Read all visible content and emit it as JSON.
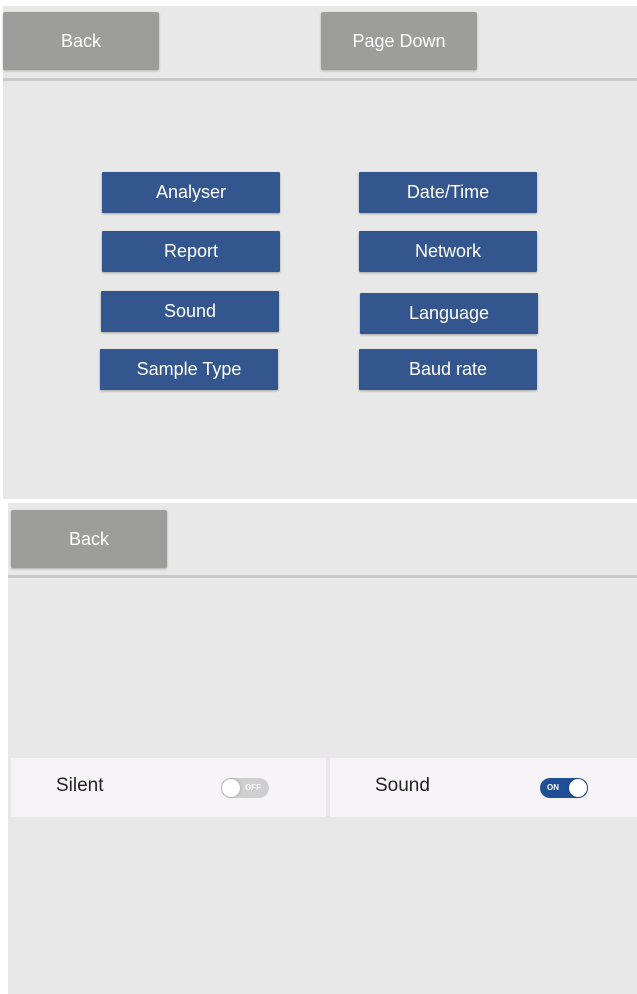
{
  "settings_menu": {
    "back_label": "Back",
    "page_down_label": "Page Down",
    "buttons": [
      "Analyser",
      "Date/Time",
      "Report",
      "Network",
      "Sound",
      "Language",
      "Sample Type",
      "Baud rate"
    ]
  },
  "sound_screen": {
    "back_label": "Back",
    "options": [
      {
        "label": "Silent",
        "toggle_text": "OFF",
        "state": "off"
      },
      {
        "label": "Sound",
        "toggle_text": "ON",
        "state": "on"
      }
    ]
  },
  "colors": {
    "menu_button_blue": "#34568f",
    "nav_button_gray": "#9d9e9a",
    "toggle_on": "#1f4f96",
    "toggle_off": "#cfcfcf",
    "panel_background": "#e8e8e8"
  }
}
